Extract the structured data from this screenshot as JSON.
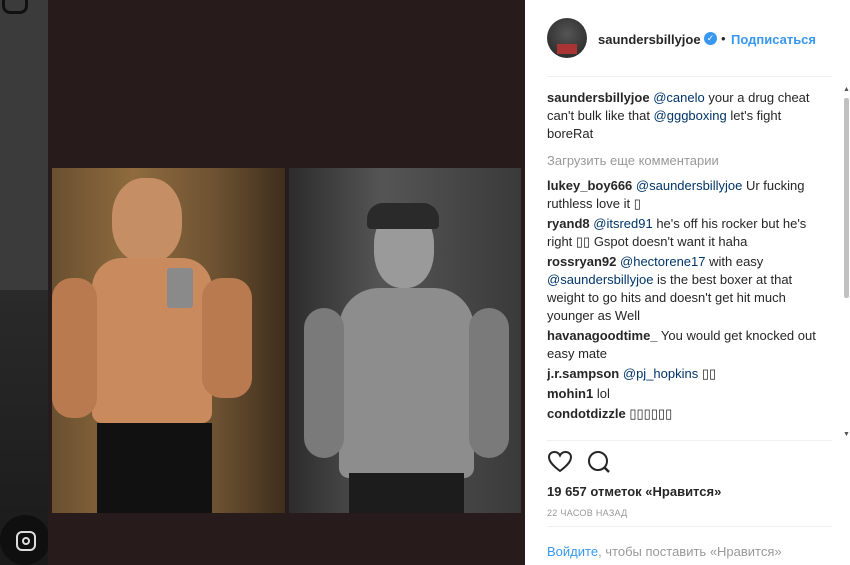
{
  "post": {
    "username": "saundersbillyjoe",
    "follow_label": "Подписаться",
    "separator": "•",
    "verified_glyph": "✓"
  },
  "comments": [
    {
      "user": "saundersbillyjoe",
      "parts": [
        {
          "t": "@canelo",
          "m": true
        },
        {
          "t": " your a drug cheat can't bulk like that ",
          "m": false
        },
        {
          "t": "@gggboxing",
          "m": true
        },
        {
          "t": " let's fight boreRat",
          "m": false
        }
      ]
    },
    {
      "load_more": "Загрузить еще комментарии"
    },
    {
      "user": "lukey_boy666",
      "parts": [
        {
          "t": "@saundersbillyjoe",
          "m": true
        },
        {
          "t": " Ur fucking ruthless love it ▯",
          "m": false
        }
      ]
    },
    {
      "user": "ryand8",
      "parts": [
        {
          "t": "@itsred91",
          "m": true
        },
        {
          "t": " he's off his rocker but he's right ▯▯ Gspot doesn't want it haha",
          "m": false
        }
      ]
    },
    {
      "user": "rossryan92",
      "parts": [
        {
          "t": "@hectorene17",
          "m": true
        },
        {
          "t": " with easy ",
          "m": false
        },
        {
          "t": "@saundersbillyjoe",
          "m": true
        },
        {
          "t": " is the best boxer at that weight to go hits and doesn't get hit much younger as Well",
          "m": false
        }
      ]
    },
    {
      "user": "havanagoodtime_",
      "parts": [
        {
          "t": "You would get knocked out easy mate",
          "m": false
        }
      ]
    },
    {
      "user": "j.r.sampson",
      "parts": [
        {
          "t": "@pj_hopkins",
          "m": true
        },
        {
          "t": " ▯▯",
          "m": false
        }
      ]
    },
    {
      "user": "mohin1",
      "parts": [
        {
          "t": "lol",
          "m": false
        }
      ]
    },
    {
      "user": "condotdizzle",
      "parts": [
        {
          "t": "▯▯▯▯▯▯",
          "m": false
        }
      ]
    }
  ],
  "actions": {
    "like_icon": "heart-icon",
    "comment_icon": "comment-bubble-icon"
  },
  "likes_text": "19 657 отметок «Нравится»",
  "time_text": "22 ЧАСОВ НАЗАД",
  "login": {
    "link": "Войдите",
    "rest": ", чтобы поставить «Нравится»"
  },
  "colors": {
    "accent": "#3897f0",
    "mention": "#003569",
    "muted": "#999999",
    "text": "#262626"
  }
}
